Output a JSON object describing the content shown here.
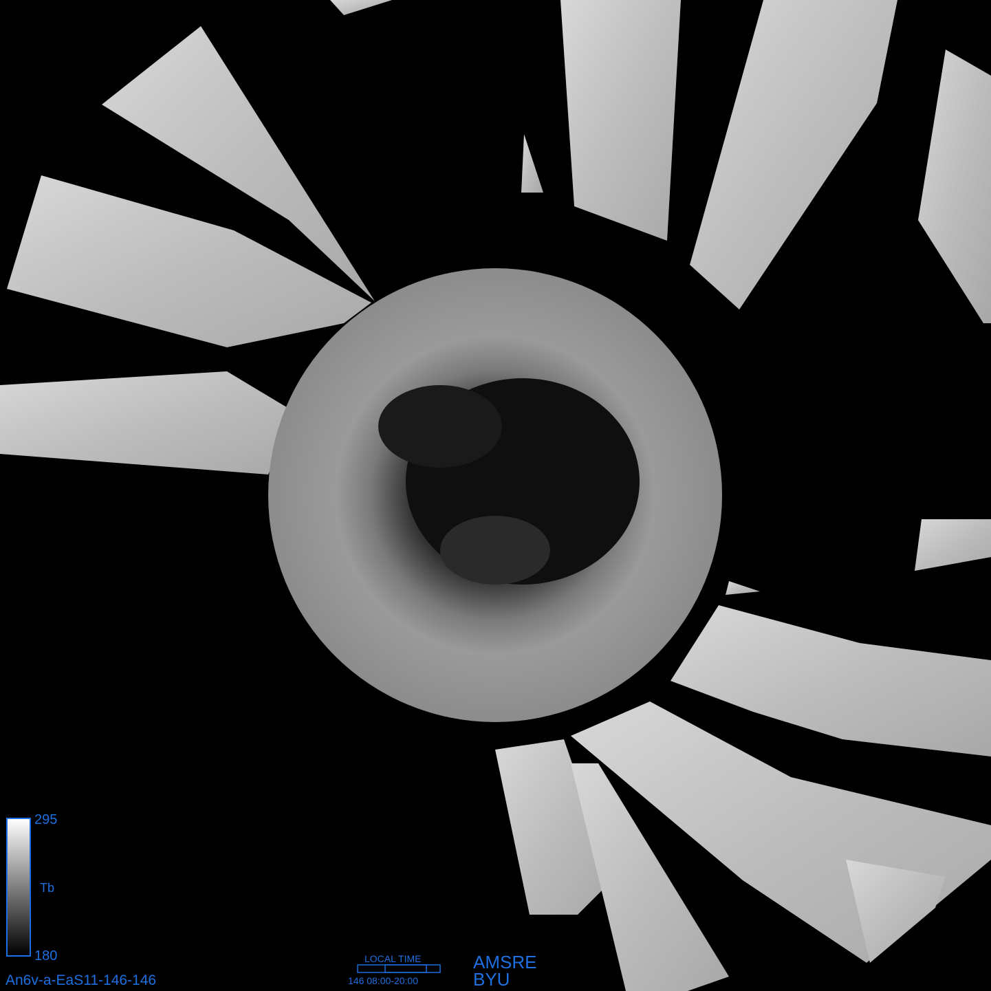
{
  "colorbar": {
    "max_label": "295",
    "mid_label": "Tb",
    "min_label": "180"
  },
  "image_id_label": "An6v-a-EaS11-146-146",
  "local_time": {
    "title": "LOCAL TIME",
    "range_label": "146 08:00-20:00"
  },
  "credits": {
    "sensor": "AMSRE",
    "institution": "BYU"
  },
  "colors": {
    "background": "#000000",
    "label_blue": "#1e6fe0"
  }
}
